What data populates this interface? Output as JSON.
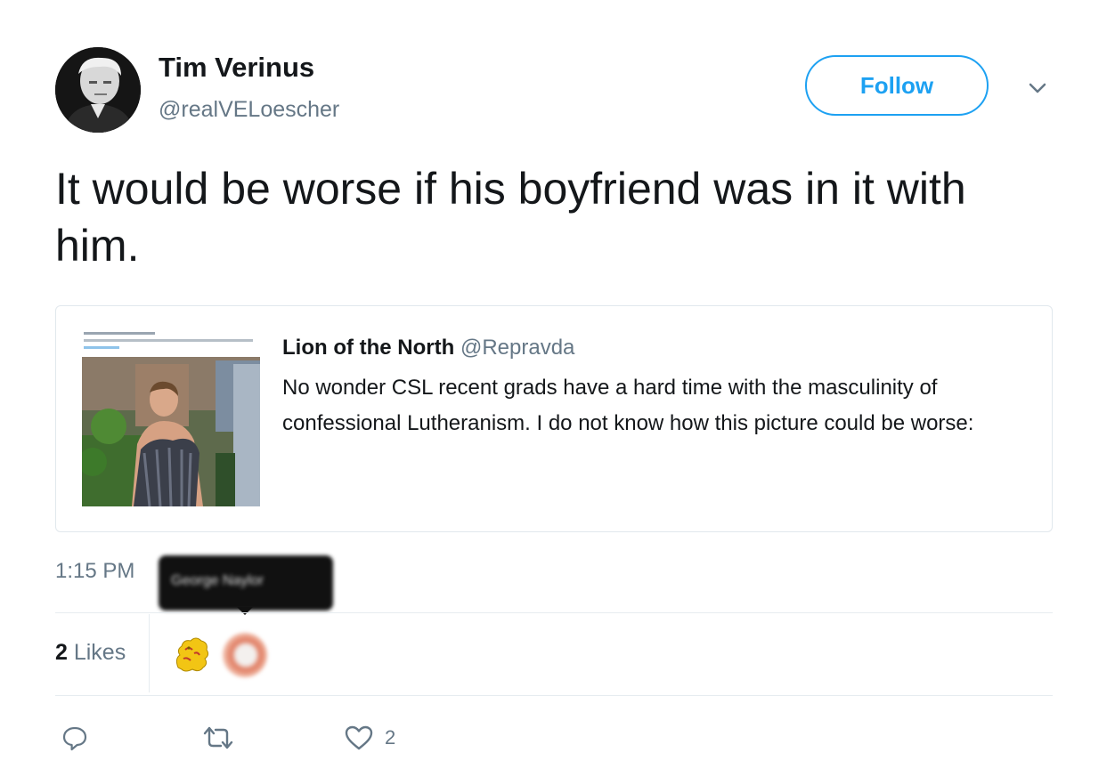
{
  "author": {
    "name": "Tim Verinus",
    "handle": "@realVELoescher"
  },
  "follow_button": {
    "label": "Follow"
  },
  "tweet": {
    "text": "It would be worse if his boyfriend was in it with him."
  },
  "quoted_tweet": {
    "name": "Lion of the North",
    "handle": "@Repravda",
    "text": "No wonder CSL recent grads have a hard time with the masculinity of confessional Lutheranism. I do not know how this picture could be worse:"
  },
  "meta": {
    "time": "1:15 PM",
    "tooltip_name": "George Naylor"
  },
  "likes": {
    "count": "2",
    "label": " Likes"
  },
  "actions": {
    "like_count": "2"
  },
  "colors": {
    "accent": "#1da1f2",
    "secondary_text": "#657786",
    "border": "#e1e8ed"
  },
  "icons": [
    "chevron-down-icon",
    "reply-icon",
    "retweet-icon",
    "heart-icon"
  ]
}
